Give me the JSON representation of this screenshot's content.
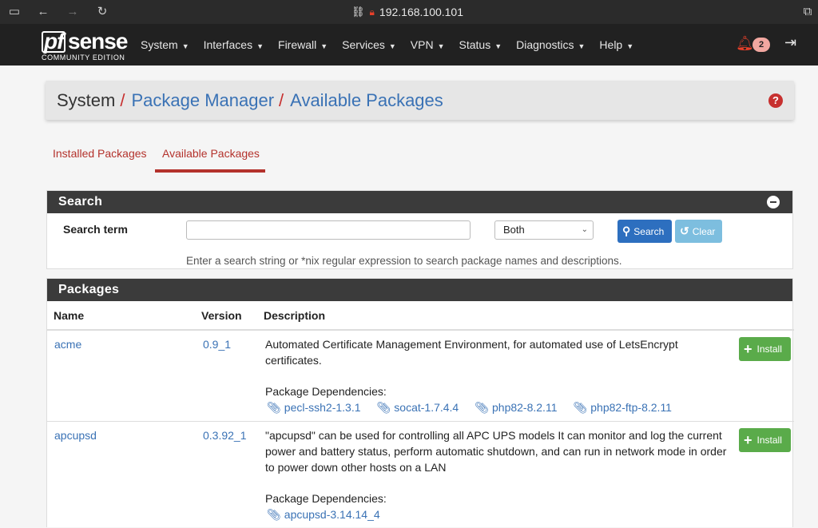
{
  "browser": {
    "url": "192.168.100.101"
  },
  "navbar": {
    "logo_pf": "pf",
    "logo_sense": "sense",
    "logo_edition": "COMMUNITY EDITION",
    "menu": [
      "System",
      "Interfaces",
      "Firewall",
      "Services",
      "VPN",
      "Status",
      "Diagnostics",
      "Help"
    ],
    "notification_count": "2"
  },
  "breadcrumb": {
    "root": "System",
    "sep": "/",
    "level1": "Package Manager",
    "level2": "Available Packages"
  },
  "tabs": {
    "installed": "Installed Packages",
    "available": "Available Packages"
  },
  "search": {
    "title": "Search",
    "label": "Search term",
    "input_value": "",
    "select_value": "Both",
    "search_button": "Search",
    "clear_button": "Clear",
    "hint": "Enter a search string or *nix regular expression to search package names and descriptions."
  },
  "packages": {
    "title": "Packages",
    "col_name": "Name",
    "col_version": "Version",
    "col_description": "Description",
    "deps_label": "Package Dependencies:",
    "install_label": "Install",
    "rows": [
      {
        "name": "acme",
        "version": "0.9_1",
        "description": "Automated Certificate Management Environment, for automated use of LetsEncrypt certificates.",
        "deps": [
          "pecl-ssh2-1.3.1",
          "socat-1.7.4.4",
          "php82-8.2.11",
          "php82-ftp-8.2.11"
        ]
      },
      {
        "name": "apcupsd",
        "version": "0.3.92_1",
        "description": "\"apcupsd\" can be used for controlling all APC UPS models It can monitor and log the current power and battery status, perform automatic shutdown, and can run in network mode in order to power down other hosts on a LAN",
        "deps": [
          "apcupsd-3.14.14_4"
        ]
      }
    ]
  },
  "colors": {
    "navbar_bg": "#212121",
    "accent_red": "#b4322c",
    "link_blue": "#3a72b5",
    "install_green": "#5aab4a",
    "search_blue": "#2d6fbf"
  }
}
